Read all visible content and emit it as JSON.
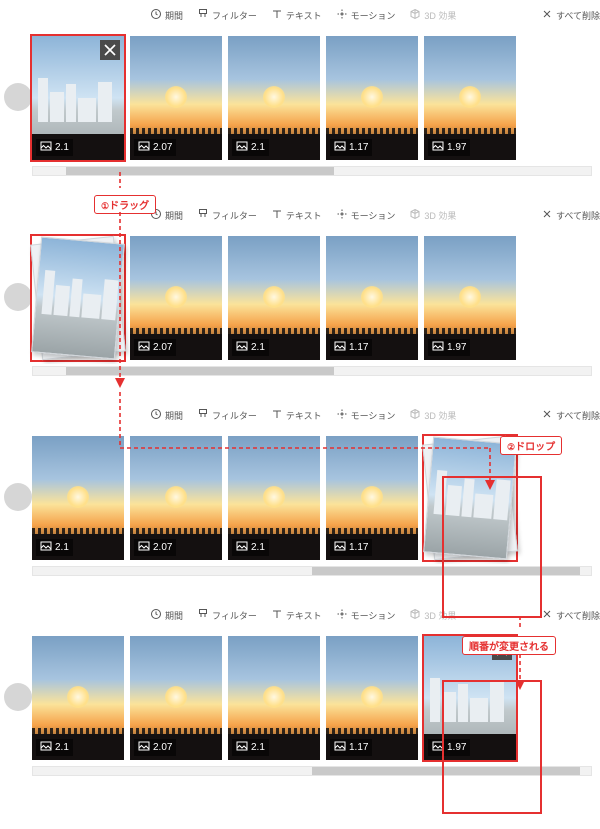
{
  "toolbar": {
    "duration": "期間",
    "filter": "フィルター",
    "text": "テキスト",
    "motion": "モーション",
    "effect3d": "3D 効果",
    "remove_all": "すべて削除"
  },
  "annotations": {
    "step1_num": "①",
    "step1_label": "ドラッグ",
    "step2_num": "②",
    "step2_label": "ドロップ",
    "result_label": "順番が変更される"
  },
  "panels": [
    {
      "scroll": {
        "left_pct": 6,
        "width_pct": 48
      },
      "thumbs": [
        {
          "kind": "city",
          "dur": "2.1",
          "selected": true,
          "close": true
        },
        {
          "kind": "sunset",
          "dur": "2.07"
        },
        {
          "kind": "sunset",
          "dur": "2.1"
        },
        {
          "kind": "sunset",
          "dur": "1.17"
        },
        {
          "kind": "sunset",
          "dur": "1.97"
        }
      ]
    },
    {
      "scroll": {
        "left_pct": 6,
        "width_pct": 48
      },
      "thumbs": [
        {
          "kind": "ghost",
          "selected": true
        },
        {
          "kind": "sunset",
          "dur": "2.07"
        },
        {
          "kind": "sunset",
          "dur": "2.1"
        },
        {
          "kind": "sunset",
          "dur": "1.17"
        },
        {
          "kind": "sunset",
          "dur": "1.97"
        }
      ]
    },
    {
      "scroll": {
        "left_pct": 50,
        "width_pct": 48
      },
      "thumbs": [
        {
          "kind": "sunset",
          "dur": "2.1"
        },
        {
          "kind": "sunset",
          "dur": "2.07"
        },
        {
          "kind": "sunset",
          "dur": "2.1"
        },
        {
          "kind": "sunset",
          "dur": "1.17"
        },
        {
          "kind": "ghost",
          "selected": true
        }
      ]
    },
    {
      "scroll": {
        "left_pct": 50,
        "width_pct": 48
      },
      "thumbs": [
        {
          "kind": "sunset",
          "dur": "2.1"
        },
        {
          "kind": "sunset",
          "dur": "2.07"
        },
        {
          "kind": "sunset",
          "dur": "2.1"
        },
        {
          "kind": "sunset",
          "dur": "1.17"
        },
        {
          "kind": "city",
          "dur": "1.97",
          "selected": true,
          "close": true
        }
      ]
    }
  ]
}
